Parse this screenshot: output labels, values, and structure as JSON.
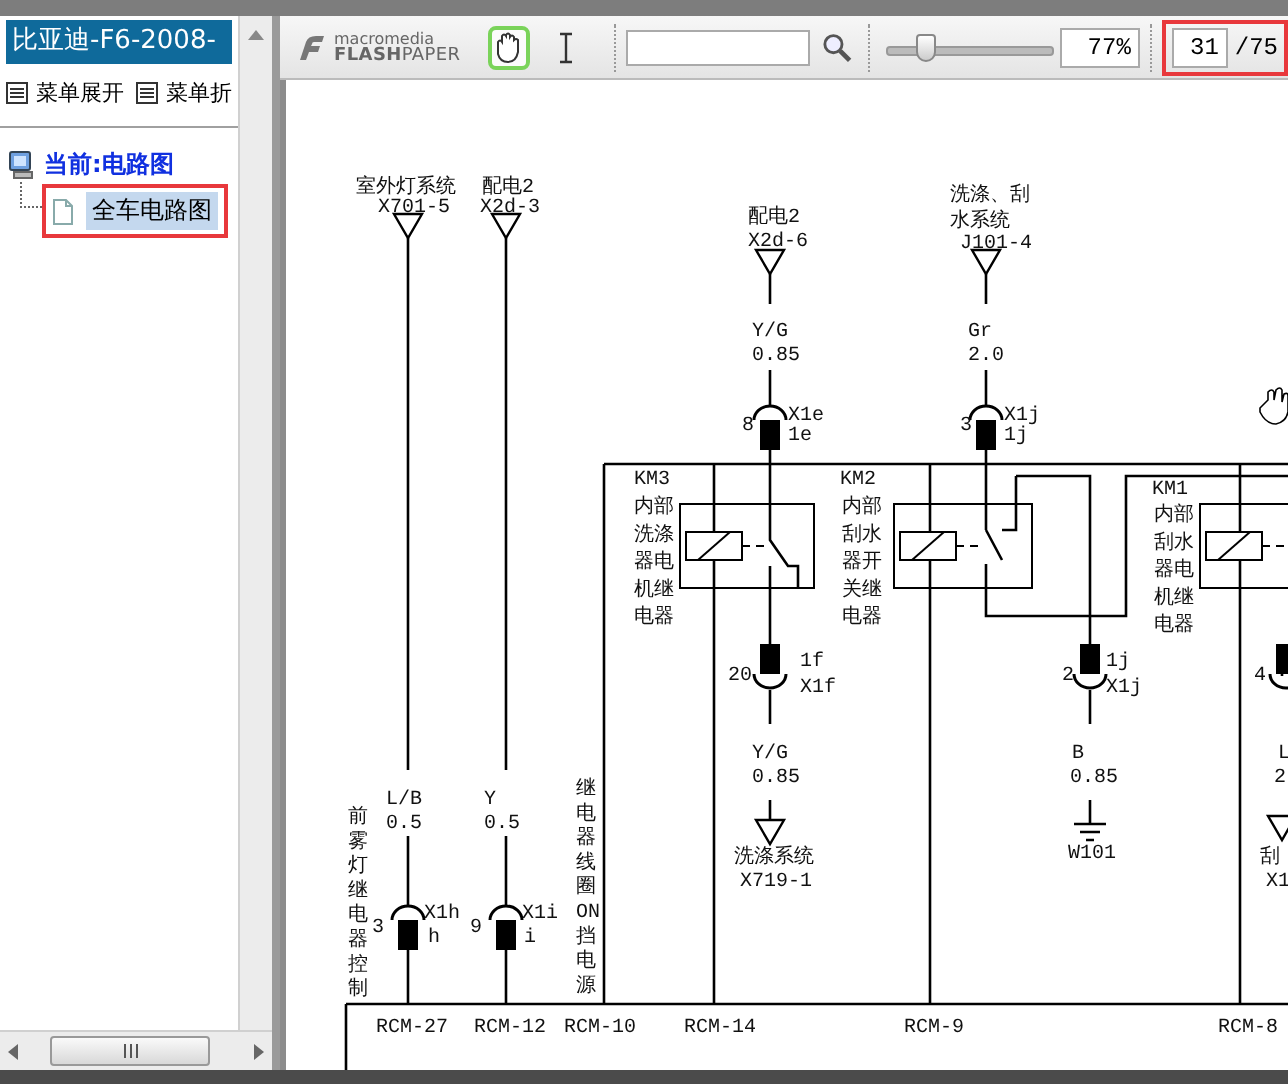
{
  "sidebar": {
    "title": "比亚迪-F6-2008-",
    "menu_buttons": [
      {
        "label": "菜单展开"
      },
      {
        "label": "菜单折"
      }
    ],
    "tree": [
      {
        "label": "当前:电路图",
        "children": [
          {
            "label": "全车电路图",
            "selected": true,
            "highlighted": true
          }
        ]
      }
    ]
  },
  "toolbar": {
    "logo": {
      "top": "macromedia",
      "bottom": "**FLASH**PAPER"
    },
    "tools": [
      {
        "kind": "hand",
        "selected": true
      },
      {
        "kind": "text",
        "selected": false
      }
    ],
    "zoom": {
      "level": 0.24,
      "reading": "77%"
    },
    "page": {
      "current": "31",
      "total": "/75",
      "highlighted": true
    }
  },
  "diagram": {
    "labels": [
      {
        "kind": "text",
        "text": "室外灯系统"
      },
      {
        "kind": "text",
        "text": "X701-5"
      },
      {
        "kind": "text",
        "text": "配电2"
      },
      {
        "kind": "text",
        "text": "X2d-3"
      },
      {
        "kind": "text",
        "text": "配电2"
      },
      {
        "kind": "text",
        "text": "X2d-6"
      },
      {
        "kind": "text",
        "text": "Y/G"
      },
      {
        "kind": "text",
        "text": "0.85"
      },
      {
        "kind": "text",
        "text": "8"
      },
      {
        "kind": "text",
        "text": "X1e"
      },
      {
        "kind": "text",
        "text": "1e"
      },
      {
        "kind": "text",
        "text": "洗涤、刮"
      },
      {
        "kind": "text",
        "text": "水系统"
      },
      {
        "kind": "text",
        "text": "J101-4"
      },
      {
        "kind": "text",
        "text": "Gr"
      },
      {
        "kind": "text",
        "text": "2.0"
      },
      {
        "kind": "text",
        "text": "3"
      },
      {
        "kind": "text",
        "text": "X1j"
      },
      {
        "kind": "text",
        "text": "1j"
      },
      {
        "kind": "text",
        "text": "KM3"
      },
      {
        "kind": "stack",
        "text": "内部洗涤器电机继电器"
      },
      {
        "kind": "text",
        "text": "KM2"
      },
      {
        "kind": "stack",
        "text": "内部刮水器开关继电器"
      },
      {
        "kind": "text",
        "text": "KM1"
      },
      {
        "kind": "stack",
        "text": "内部刮水器电机继电器"
      },
      {
        "kind": "text",
        "text": "20"
      },
      {
        "kind": "text",
        "text": "1f"
      },
      {
        "kind": "text",
        "text": "X1f"
      },
      {
        "kind": "text",
        "text": "Y/G"
      },
      {
        "kind": "text",
        "text": "0.85"
      },
      {
        "kind": "text",
        "text": "洗涤系统"
      },
      {
        "kind": "text",
        "text": "X719-1"
      },
      {
        "kind": "text",
        "text": "2"
      },
      {
        "kind": "text",
        "text": "1j"
      },
      {
        "kind": "text",
        "text": "X1j"
      },
      {
        "kind": "text",
        "text": "B"
      },
      {
        "kind": "text",
        "text": "0.85"
      },
      {
        "kind": "text",
        "text": "W101"
      },
      {
        "kind": "text",
        "text": "4"
      },
      {
        "kind": "text",
        "text": "L"
      },
      {
        "kind": "text",
        "text": "2"
      },
      {
        "kind": "text",
        "text": "刮"
      },
      {
        "kind": "text",
        "text": "X1"
      },
      {
        "kind": "vertical",
        "text": "前雾灯继电器控制"
      },
      {
        "kind": "text",
        "text": "L/B"
      },
      {
        "kind": "text",
        "text": "0.5"
      },
      {
        "kind": "text",
        "text": "Y"
      },
      {
        "kind": "text",
        "text": "0.5"
      },
      {
        "kind": "text",
        "text": "3"
      },
      {
        "kind": "text",
        "text": "X1h"
      },
      {
        "kind": "text",
        "text": "h"
      },
      {
        "kind": "text",
        "text": "9"
      },
      {
        "kind": "text",
        "text": "X1i"
      },
      {
        "kind": "text",
        "text": "i"
      },
      {
        "kind": "vertical",
        "text": "继电器线圈ON挡电源"
      },
      {
        "kind": "text",
        "text": "RCM-27"
      },
      {
        "kind": "text",
        "text": "RCM-12"
      },
      {
        "kind": "text",
        "text": "RCM-10"
      },
      {
        "kind": "text",
        "text": "RCM-14"
      },
      {
        "kind": "text",
        "text": "RCM-9"
      },
      {
        "kind": "text",
        "text": "RCM-8"
      }
    ]
  }
}
